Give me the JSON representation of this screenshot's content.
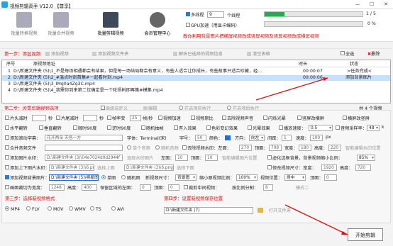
{
  "titlebar": {
    "title": "视频剪辑高手 V12.0  【尊享】",
    "min": "—",
    "max": "☐",
    "close": "✕"
  },
  "toolbar": {
    "btn1": "批量转换视频",
    "btn2": "批量合并视频",
    "btn3": "批量剪辑视频",
    "btn4": "会员管理中心",
    "multithread": "多线程",
    "thread_count": "9",
    "thread_unit": "个线程",
    "gpu": "GPU加速（用显卡编码）",
    "progress1": "1 / 5",
    "progress2": "0 %",
    "progress1_value": 0.2,
    "progress2_value": 0,
    "notice": "教你利用背景图片把横屏视频改成竖屏视频及竖屏视频改成横屏视频"
  },
  "step1": {
    "title": "第一步：添加视频",
    "add_video": "添加视频",
    "add_folder": "添加视频文件夹",
    "parse": "解析已选择的视频信息",
    "clear": "清空表格",
    "select_all": "全选",
    "delete": "删除"
  },
  "list": {
    "headers": {
      "no": "序号",
      "addr": "原视频地址",
      "duration": "时长",
      "status": "状态"
    },
    "rows": [
      {
        "no": "1",
        "addr": "D:\\新建文件夹 (5)\\1_不是每场相遇都会有结果，但是每一场结局都会有意义，有些人适合让你成长，有些故事只适合珍藏，经...",
        "duration": "00:00:07",
        "status": ">任务完成<"
      },
      {
        "no": "2",
        "addr": "D:\\新建文件夹 (5)\\2_#温点时刻首集#一起看时刻.mp4",
        "duration": "00:00:06",
        "status": "添加背景图片"
      },
      {
        "no": "3",
        "addr": "D:\\新建文件夹 (5)\\3_IMg0a4Zg3C.mp4",
        "duration": "",
        "status": ""
      },
      {
        "no": "4",
        "addr": "D:\\新建文件夹 (5)\\4_我需你到来第二位确定是一个轮扬树即再集#模集.mp4",
        "duration": "",
        "status": ""
      }
    ],
    "total": "共 4 个视频"
  },
  "step2": {
    "title": "第二步：设置剪辑视频选项",
    "advanced": "高级自定义",
    "edit": "编辑",
    "run_before": "在选项前执行",
    "run_after": "在选项后执行"
  },
  "opts": {
    "r1": [
      "片头减时",
      "秒",
      "片尾减时",
      "秒",
      "帧率变",
      "25",
      "帧/秒",
      "视频加速",
      "视频原比",
      "去除视频声音",
      "闪烁光晕",
      "竖屏改横屏",
      "横屏改竖屏"
    ],
    "r2": [
      "水平翻转",
      "垂直翻转",
      "顺时90度",
      "逆时90度",
      "随机抽帧",
      "有入效果",
      "色彩变幻效果",
      "光晕效果",
      "播放速度：",
      "0.5",
      "音频采样率：",
      "48",
      "k"
    ],
    "r3_label": "添加滚动字幕：",
    "r3_text": "花开两朵 天各一方",
    "r3_font": "字体：Terminal(宋)",
    "r3_size": "字号：",
    "r3_size_v": "50",
    "r3_color": "颜色：",
    "r3_dir": "方向：",
    "r3_dir_v": "向左",
    "r3_time": "间距：",
    "r3_time_v": "1",
    "r3_speed": "速度：",
    "r3_speed_v": "100",
    "r3_px": "px",
    "r4_label": "合并音频文件",
    "r4_single": "单个音频",
    "r4_random": "随机音频",
    "r4_keep": "去除视频水印：左面：",
    "r4_left": "270",
    "r4_top_l": "顶面：",
    "r4_top": "708",
    "r4_w_l": "宽度：",
    "r4_w": "180",
    "r4_h_l": "高度：",
    "r4_h": "220",
    "r4_smart": "智能编辑水印位置",
    "r5_label": "添加图片水印：",
    "r5_path": "D:\\新建文件夹 (3)\\04e7024d0d2944f",
    "r5_select": "选择水印图片",
    "r5_left": "左面：",
    "r5_left_v": "10",
    "r5_top": "顶面：",
    "r5_top_v": "10",
    "r5_smart": "智能编辑图片位置",
    "r5_blur": "虚化边框背景，背景视频缩小比例：",
    "r5_blur_v": "85%",
    "r6_label": "添加上下图片水印：",
    "r6_path": "D:\\新建文件夹 (3)\\6.png",
    "r6_sel_top": "选择上面",
    "r6_path2": "D:\\新建文件夹 (3)\\6.png",
    "r6_sel_bot": "选择下面",
    "r6_resize": "修改视频尺寸：宽度：",
    "r6_w": "1920",
    "r6_h_l": "高度：",
    "r6_h": "720",
    "r7_label": "添加视频背景图片：",
    "r7_path": "D:\\新建文件夹 (5)\\明星图",
    "r7_single": "单图",
    "r7_random": "随机图",
    "r7_new": "新视频尺寸：",
    "r7_new_v": "背景图",
    "r7_scale": "缩小原视频比例：",
    "r7_scale_v": "100%",
    "r7_pos": "视频位置：",
    "r7_pos_v": "居中",
    "r7_top": "顶面：",
    "r7_top_v": "0",
    "r8_label": "画面裁切为宽度：",
    "r8_w": "1248",
    "r8_h_l": "高度：",
    "r8_h": "400",
    "r8_crop": "保留区域的左面：",
    "r8_left": "0",
    "r8_top_l": "顶面：",
    "r8_top": "0",
    "r8_cut": "裁剪中间视频：",
    "r8_mode": "模式二",
    "r8_side": "按比例分割：",
    "r8_ratio": "8"
  },
  "step3": {
    "title": "第三步：选择新视频格式",
    "formats": [
      "MP4",
      "FLV",
      "MOV",
      "WMV",
      "TS",
      "AVI"
    ],
    "selected": "MP4"
  },
  "step4": {
    "title": "第四步：设置新视频保存位置",
    "path": "D:\\新建文件夹 (7)",
    "open": "打开文件夹",
    "start": "开始剪辑"
  },
  "colors": {
    "accent": "#1b6fe0",
    "red": "#e01010",
    "green": "#1db04a"
  }
}
